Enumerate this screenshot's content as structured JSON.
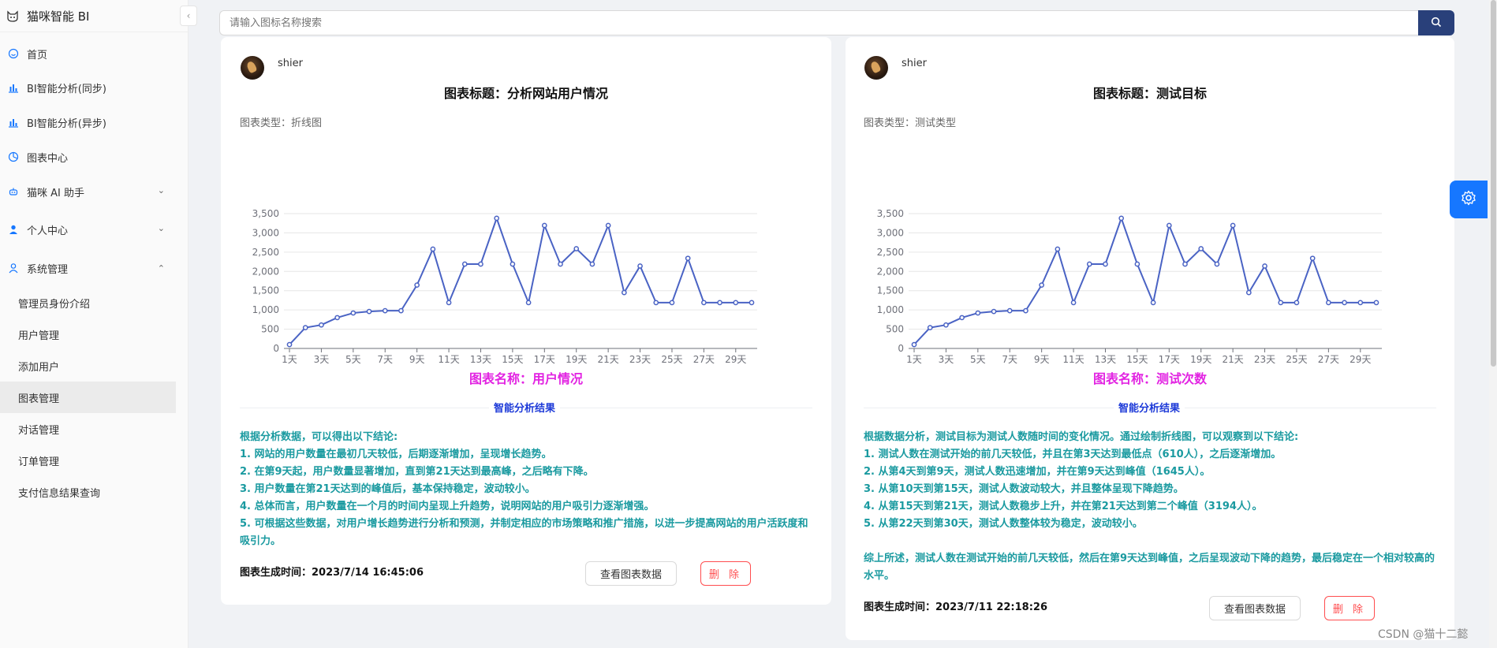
{
  "app": {
    "title": "猫咪智能 BI"
  },
  "sidebar": {
    "items": [
      {
        "label": "首页",
        "icon": "smile-icon"
      },
      {
        "label": "BI智能分析(同步)",
        "icon": "bar-chart-icon"
      },
      {
        "label": "BI智能分析(异步)",
        "icon": "bar-chart-icon"
      },
      {
        "label": "图表中心",
        "icon": "pie-chart-icon"
      },
      {
        "label": "猫咪 AI 助手",
        "icon": "robot-icon",
        "expandable": true
      },
      {
        "label": "个人中心",
        "icon": "user-icon",
        "expandable": true
      },
      {
        "label": "系统管理",
        "icon": "user-outline-icon",
        "expanded": true
      }
    ],
    "sub_items": [
      {
        "label": "管理员身份介绍"
      },
      {
        "label": "用户管理"
      },
      {
        "label": "添加用户"
      },
      {
        "label": "图表管理",
        "active": true
      },
      {
        "label": "对话管理"
      },
      {
        "label": "订单管理"
      },
      {
        "label": "支付信息结果查询"
      }
    ]
  },
  "search": {
    "placeholder": "请输入图标名称搜索"
  },
  "cards": [
    {
      "username": "shier",
      "chart_title": "图表标题：分析网站用户情况",
      "chart_type": "图表类型：折线图",
      "chart_name": "图表名称：用户情况",
      "analysis_heading": "智能分析结果",
      "analysis_lines": [
        "根据分析数据，可以得出以下结论:",
        "1. 网站的用户数量在最初几天较低，后期逐渐增加，呈现增长趋势。",
        "2. 在第9天起，用户数量显著增加，直到第21天达到最高峰，之后略有下降。",
        "3. 用户数量在第21天达到的峰值后，基本保持稳定，波动较小。",
        "4. 总体而言，用户数量在一个月的时间内呈现上升趋势，说明网站的用户吸引力逐渐增强。",
        "5. 可根据这些数据，对用户增长趋势进行分析和预测，并制定相应的市场策略和推广措施，以进一步提高网站的用户活跃度和吸引力。"
      ],
      "gen_time": "图表生成时间：2023/7/14 16:45:06",
      "view_label": "查看图表数据",
      "delete_label": "删 除"
    },
    {
      "username": "shier",
      "chart_title": "图表标题：测试目标",
      "chart_type": "图表类型：测试类型",
      "chart_name": "图表名称：测试次数",
      "analysis_heading": "智能分析结果",
      "analysis_lines": [
        "根据数据分析，测试目标为测试人数随时间的变化情况。通过绘制折线图，可以观察到以下结论:",
        "1. 测试人数在测试开始的前几天较低，并且在第3天达到最低点（610人），之后逐渐增加。",
        "2. 从第4天到第9天，测试人数迅速增加，并在第9天达到峰值（1645人）。",
        "3. 从第10天到第15天，测试人数波动较大，并且整体呈现下降趋势。",
        "4. 从第15天到第21天，测试人数稳步上升，并在第21天达到第二个峰值（3194人）。",
        "5. 从第22天到第30天，测试人数整体较为稳定，波动较小。",
        "",
        "综上所述，测试人数在测试开始的前几天较低，然后在第9天达到峰值，之后呈现波动下降的趋势，最后稳定在一个相对较高的水平。"
      ],
      "gen_time": "图表生成时间：2023/7/11 22:18:26",
      "view_label": "查看图表数据",
      "delete_label": "删 除"
    }
  ],
  "chart_data": [
    {
      "type": "line",
      "x": [
        "1天",
        "2天",
        "3天",
        "4天",
        "5天",
        "6天",
        "7天",
        "8天",
        "9天",
        "10天",
        "11天",
        "12天",
        "13天",
        "14天",
        "15天",
        "16天",
        "17天",
        "18天",
        "19天",
        "20天",
        "21天",
        "22天",
        "23天",
        "24天",
        "25天",
        "26天",
        "27天",
        "28天",
        "29天",
        "30天"
      ],
      "x_tick_labels": [
        "1天",
        "3天",
        "5天",
        "7天",
        "9天",
        "11天",
        "13天",
        "15天",
        "17天",
        "19天",
        "21天",
        "23天",
        "25天",
        "27天",
        "29天"
      ],
      "y_tick_labels": [
        "0",
        "500",
        "1,000",
        "1,500",
        "2,000",
        "2,500",
        "3,000",
        "3,500"
      ],
      "values": [
        100,
        540,
        610,
        800,
        920,
        960,
        980,
        980,
        1645,
        2580,
        1190,
        2190,
        2190,
        3380,
        2190,
        1190,
        3194,
        2190,
        2590,
        2190,
        3194,
        1450,
        2140,
        1190,
        1190,
        2340,
        1190,
        1190,
        1190,
        1190
      ],
      "ylim": [
        0,
        3500
      ],
      "color": "#4a63c4",
      "grid": true
    },
    {
      "type": "line",
      "x": [
        "1天",
        "2天",
        "3天",
        "4天",
        "5天",
        "6天",
        "7天",
        "8天",
        "9天",
        "10天",
        "11天",
        "12天",
        "13天",
        "14天",
        "15天",
        "16天",
        "17天",
        "18天",
        "19天",
        "20天",
        "21天",
        "22天",
        "23天",
        "24天",
        "25天",
        "26天",
        "27天",
        "28天",
        "29天",
        "30天"
      ],
      "x_tick_labels": [
        "1天",
        "3天",
        "5天",
        "7天",
        "9天",
        "11天",
        "13天",
        "15天",
        "17天",
        "19天",
        "21天",
        "23天",
        "25天",
        "27天",
        "29天"
      ],
      "y_tick_labels": [
        "0",
        "500",
        "1,000",
        "1,500",
        "2,000",
        "2,500",
        "3,000",
        "3,500"
      ],
      "values": [
        100,
        540,
        610,
        800,
        920,
        960,
        980,
        980,
        1645,
        2580,
        1190,
        2190,
        2190,
        3380,
        2190,
        1190,
        3194,
        2190,
        2590,
        2190,
        3194,
        1450,
        2140,
        1190,
        1190,
        2340,
        1190,
        1190,
        1190,
        1190
      ],
      "ylim": [
        0,
        3500
      ],
      "color": "#4a63c4",
      "grid": true
    }
  ],
  "settings_button": {
    "icon": "gear-icon"
  },
  "watermark": "CSDN @猫十二懿"
}
